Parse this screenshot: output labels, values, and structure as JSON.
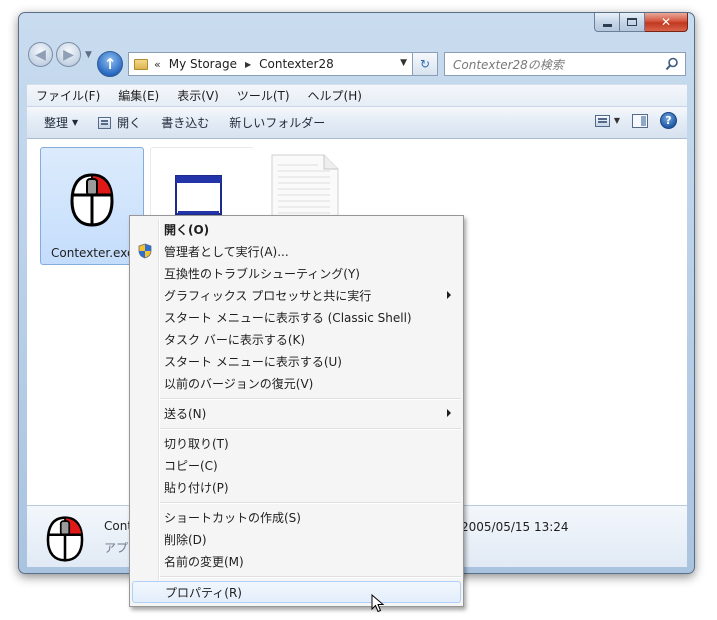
{
  "window": {
    "caption": {
      "minimize": "minimize",
      "maximize": "maximize",
      "close": "✕"
    }
  },
  "address": {
    "overflow": "«",
    "crumbs": [
      "My Storage",
      "Contexter28"
    ],
    "search_placeholder": "Contexter28の検索"
  },
  "menubar": {
    "items": [
      "ファイル(F)",
      "編集(E)",
      "表示(V)",
      "ツール(T)",
      "ヘルプ(H)"
    ]
  },
  "toolbar": {
    "organize": "整理",
    "open": "開く",
    "burn": "書き込む",
    "new_folder": "新しいフォルダー"
  },
  "files": [
    {
      "label": "Contexter.exe",
      "icon": "mouse-icon",
      "selected": true
    },
    {
      "label": "",
      "icon": "window-app-icon",
      "selected": false
    },
    {
      "label": "",
      "icon": "text-document-icon",
      "selected": false
    }
  ],
  "details": {
    "name": "Cont",
    "type": "アプ",
    "date": "2005/05/15 13:24"
  },
  "context_menu": {
    "open": "開く(O)",
    "run_as_admin": "管理者として実行(A)...",
    "troubleshoot": "互換性のトラブルシューティング(Y)",
    "run_with_gpu": "グラフィックス プロセッサと共に実行",
    "pin_start_classic": "スタート メニューに表示する (Classic Shell)",
    "pin_taskbar": "タスク バーに表示する(K)",
    "pin_start": "スタート メニューに表示する(U)",
    "restore_versions": "以前のバージョンの復元(V)",
    "send_to": "送る(N)",
    "cut": "切り取り(T)",
    "copy": "コピー(C)",
    "paste": "貼り付け(P)",
    "create_shortcut": "ショートカットの作成(S)",
    "delete": "削除(D)",
    "rename": "名前の変更(M)",
    "properties": "プロパティ(R)"
  },
  "colors": {
    "accent": "#2b6ac2",
    "selection": "#c4ddfc",
    "close_button": "#c0381f"
  }
}
